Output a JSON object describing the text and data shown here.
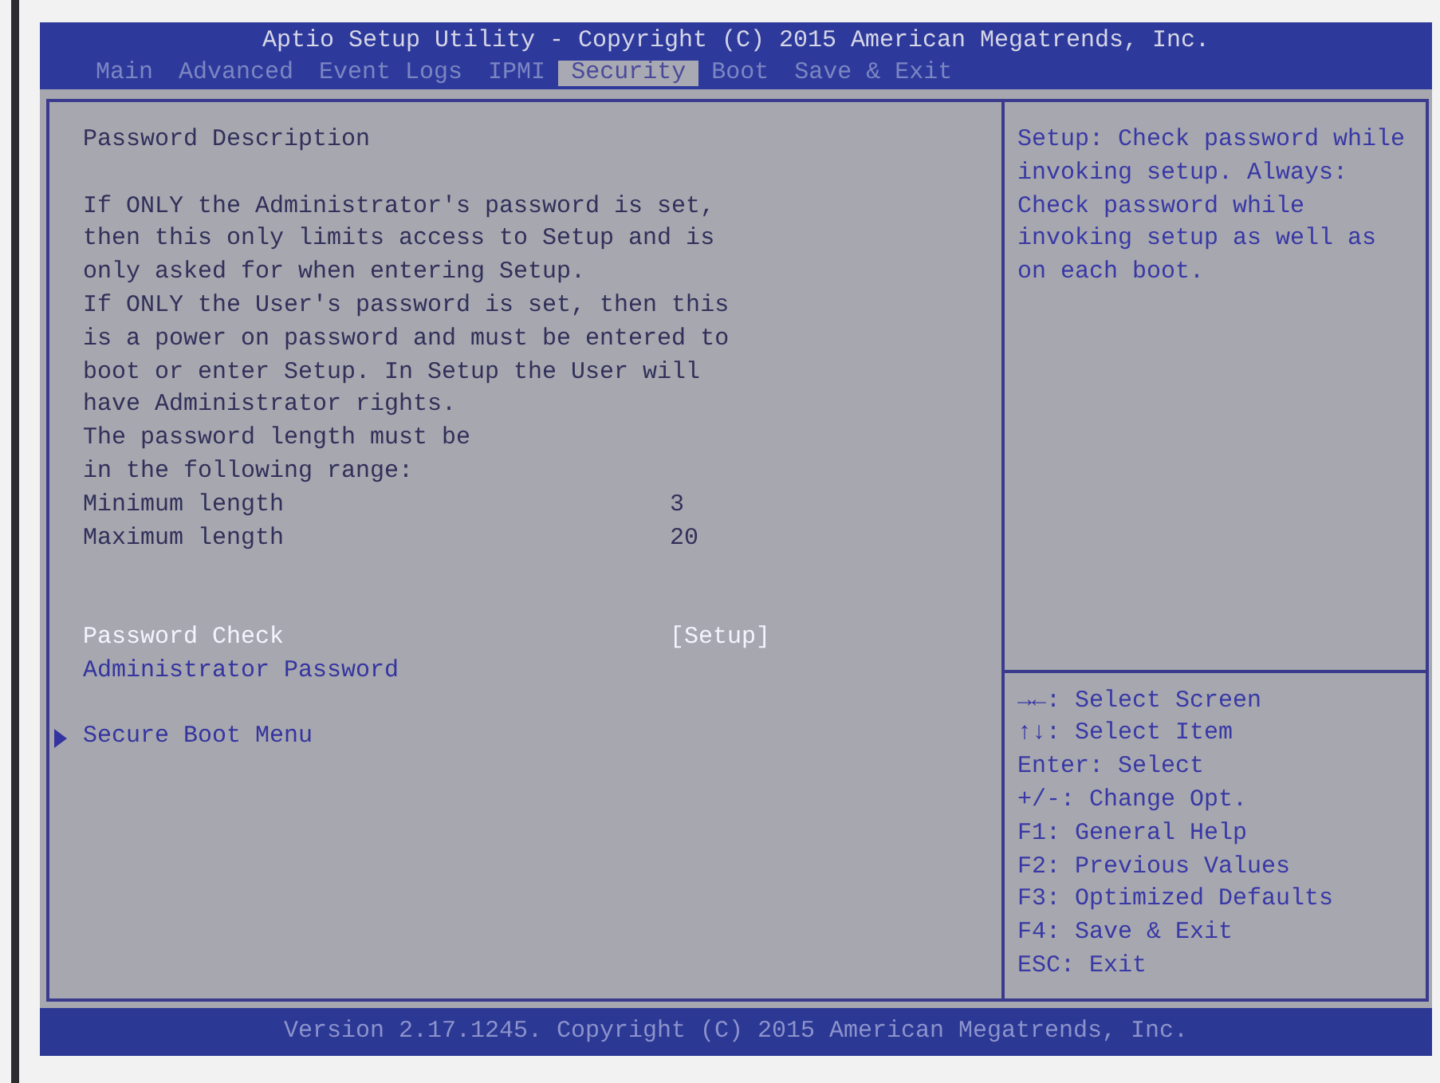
{
  "window": {
    "title": "Aptio Setup Utility - Copyright (C) 2015 American Megatrends, Inc."
  },
  "tabs": [
    {
      "label": "Main",
      "selected": false
    },
    {
      "label": "Advanced",
      "selected": false
    },
    {
      "label": "Event Logs",
      "selected": false
    },
    {
      "label": "IPMI",
      "selected": false
    },
    {
      "label": "Security",
      "selected": true
    },
    {
      "label": "Boot",
      "selected": false
    },
    {
      "label": "Save & Exit",
      "selected": false
    }
  ],
  "description": {
    "heading": "Password Description",
    "paragraphs": [
      "If ONLY the Administrator's password is set, then this only limits access to Setup and is only asked for when entering Setup.",
      "If ONLY the User's password is set, then this is a power on password and must be entered to boot or enter Setup. In Setup the User will have Administrator rights.",
      "The password length must be",
      "in the following range:"
    ]
  },
  "length_range": [
    {
      "label": "Minimum length",
      "value": "3"
    },
    {
      "label": "Maximum length",
      "value": "20"
    }
  ],
  "settings": [
    {
      "kind": "option",
      "label": "Password Check",
      "value": "[Setup]",
      "selected": true
    },
    {
      "kind": "action",
      "label": "Administrator Password",
      "selected": false
    },
    {
      "kind": "submenu",
      "label": "Secure Boot Menu",
      "selected": false
    }
  ],
  "help": {
    "text": "Setup: Check password while invoking setup. Always: Check password while invoking setup as well as on each boot.",
    "keys": [
      "→←: Select Screen",
      "↑↓: Select Item",
      "Enter: Select",
      "+/-: Change Opt.",
      "F1: General Help",
      "F2: Previous Values",
      "F3: Optimized Defaults",
      "F4: Save & Exit",
      "ESC: Exit"
    ]
  },
  "footer": {
    "version": "Version 2.17.1245. Copyright (C) 2015 American Megatrends, Inc."
  }
}
